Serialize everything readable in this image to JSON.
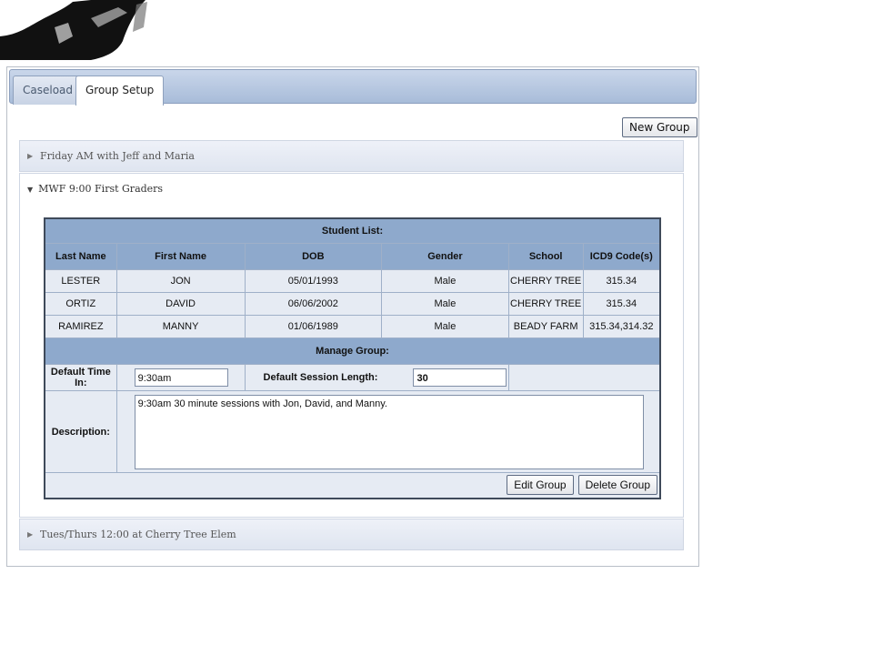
{
  "tabs": [
    {
      "label": "Caseload",
      "active": false
    },
    {
      "label": "Group Setup",
      "active": true
    }
  ],
  "toolbar": {
    "new_group_label": "New Group"
  },
  "groups": [
    {
      "label": "Friday AM with Jeff and Maria",
      "expanded": false
    },
    {
      "label": "MWF 9:00 First Graders",
      "expanded": true
    },
    {
      "label": "Tues/Thurs 12:00 at Cherry Tree Elem",
      "expanded": false
    }
  ],
  "student_list": {
    "title": "Student List:",
    "columns": [
      "Last Name",
      "First Name",
      "DOB",
      "Gender",
      "School",
      "ICD9 Code(s)"
    ],
    "rows": [
      [
        "LESTER",
        "JON",
        "05/01/1993",
        "Male",
        "CHERRY TREE",
        "315.34"
      ],
      [
        "ORTIZ",
        "DAVID",
        "06/06/2002",
        "Male",
        "CHERRY TREE",
        "315.34"
      ],
      [
        "RAMIREZ",
        "MANNY",
        "01/06/1989",
        "Male",
        "BEADY FARM",
        "315.34,314.32"
      ]
    ]
  },
  "manage_group": {
    "title": "Manage Group:",
    "time_in_label": "Default Time In:",
    "time_in_value": "9:30am",
    "session_length_label": "Default Session Length:",
    "session_length_value": "30",
    "description_label": "Description:",
    "description_value": "9:30am 30 minute sessions with Jon, David, and Manny.",
    "edit_label": "Edit Group",
    "delete_label": "Delete Group"
  },
  "icons": {
    "collapsed": "triangle-right-icon",
    "expanded": "triangle-down-icon"
  }
}
